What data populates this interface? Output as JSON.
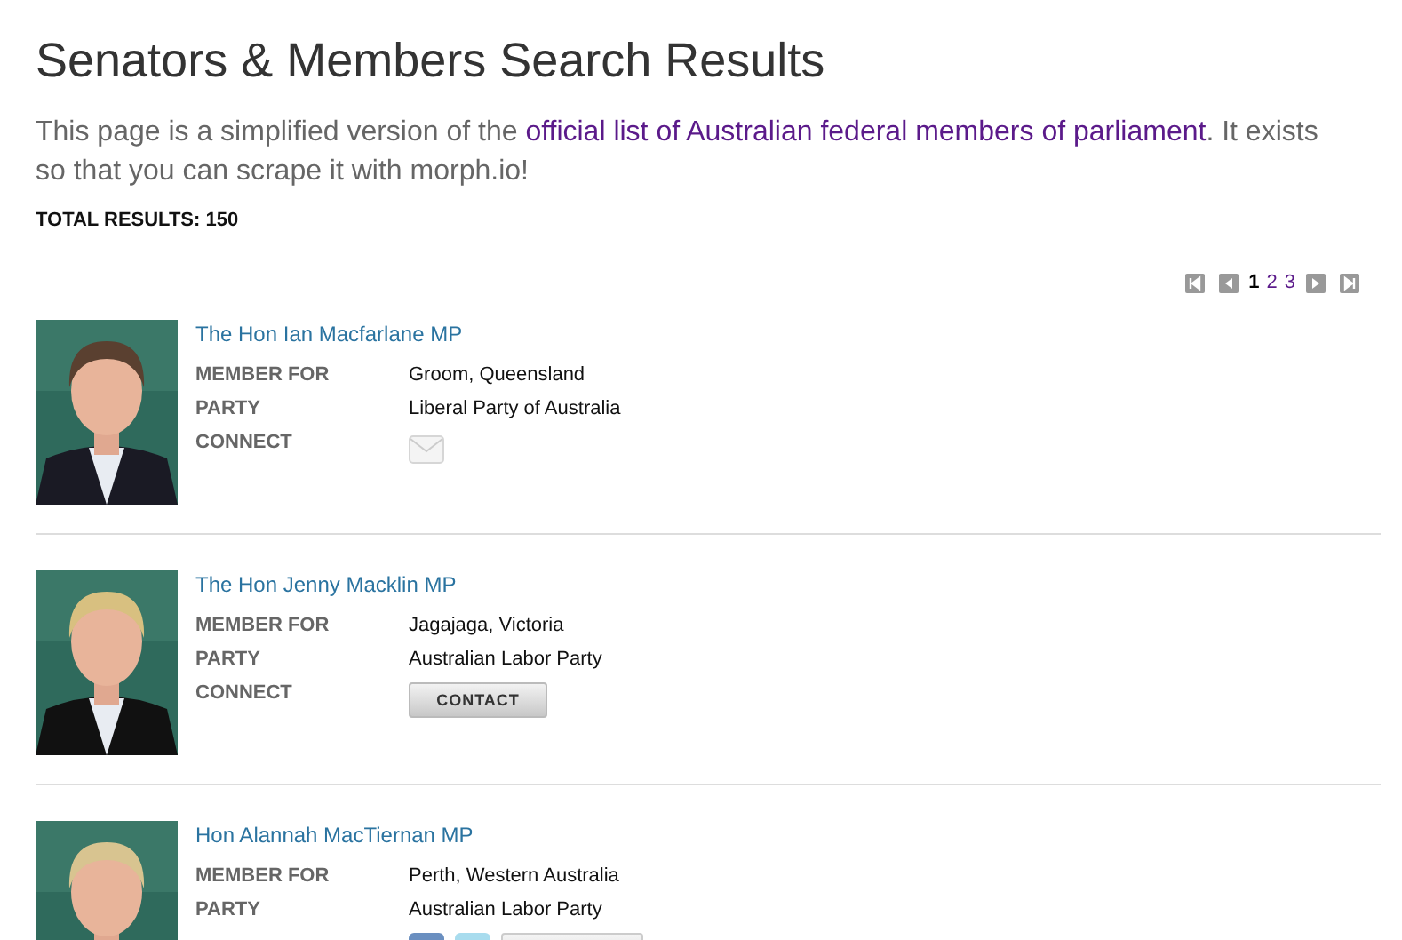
{
  "title": "Senators & Members Search Results",
  "intro": {
    "before": "This page is a simplified version of the ",
    "link": "official list of Australian federal members of parliament",
    "after": ". It exists so that you can scrape it with morph.io!"
  },
  "total": "TOTAL RESULTS: 150",
  "pagination": [
    {
      "label": "1",
      "selected": true
    },
    {
      "label": "2",
      "selected": false
    },
    {
      "label": "3",
      "selected": false
    }
  ],
  "members": [
    {
      "name": "The Hon Ian Macfarlane MP",
      "member_for_label": "MEMBER FOR",
      "member_for": "Groom, Queensland",
      "party_label": "PARTY",
      "party": "Liberal Party of Australia",
      "connect_label": "CONNECT",
      "connect": {
        "kind": "email"
      },
      "kind": "picture"
    },
    {
      "name": "The Hon Jenny Macklin MP",
      "member_for_label": "MEMBER FOR",
      "member_for": "Jagajaga, Victoria",
      "party_label": "PARTY",
      "party": "Australian Labor Party",
      "connect_label": "CONNECT",
      "connect": {
        "kind": "contact",
        "label": "CONTACT"
      },
      "kind": "picture"
    },
    {
      "name": "Hon Alannah MacTiernan MP",
      "member_for_label": "MEMBER FOR",
      "member_for": "Perth, Western Australia",
      "party_label": "PARTY",
      "party": "Australian Labor Party",
      "connect": {
        "kind": "social"
      },
      "kind": "picture"
    }
  ]
}
